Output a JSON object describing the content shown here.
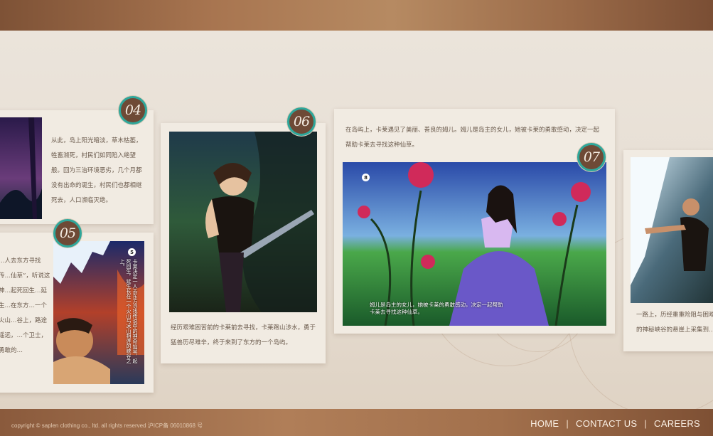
{
  "panels": [
    {
      "badge": "04",
      "caption": "从此，岛上阳光暗淡，草木枯萎，牲畜濒死，村民们如同陷入绝望般。回为三治环境恶劣，几个月都没有出命的诞生，村民们也都相继死去，人口濒临灭绝。"
    },
    {
      "badge": "05",
      "caption_left": "…人去东方寻找传…仙草”，听说这神…起死回生…延生…在东方…一个火山…谷上，路途遥远，…个卫士，勇敢的…",
      "number": "5",
      "vertical_text": "卡莱决定一人去东方寻找传说中的神奇仙草，起死回生，延生长在一个火山与冰山相连的峡谷之上。"
    },
    {
      "badge": "06",
      "caption": "经历艰难困苦前的卡莱前去寻找，卡莱跑山涉水，勇于猛兽历尽难辛，终于来到了东方的一个岛屿。"
    },
    {
      "badge": "07",
      "caption": "在岛屿上，卡莱遇见了美丽、善良的姆儿。姆儿是岛主的女儿，她被卡莱的勇敢感动，决定一起帮助卡莱去寻找这种仙草。",
      "number": "8",
      "overlay": "姆儿是岛主的女儿，她被卡莱的勇敢感动，决定一起帮助卡莱去寻找这种仙草。"
    },
    {
      "caption": "一路上，历经重重险阻与困难…中的神秘峡谷的悬崖上采集到…"
    }
  ],
  "footer": {
    "copyright": "copyright © saplen clothing co., ltd. all rights reserved  沪ICP备 06010868 号",
    "nav": [
      "HOME",
      "CONTACT US",
      "CAREERS"
    ],
    "separator": "|"
  }
}
